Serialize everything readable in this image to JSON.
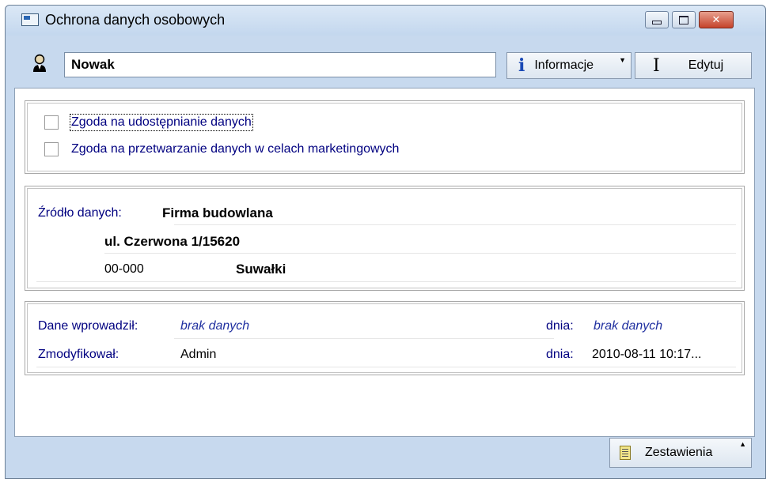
{
  "window": {
    "title": "Ochrona danych osobowych",
    "controls": {
      "minimize": "minimize",
      "maximize": "maximize",
      "close": "close"
    }
  },
  "header": {
    "name_value": "Nowak",
    "info_button": {
      "label": "Informacje",
      "icon": "info-icon"
    },
    "edit_button": {
      "label": "Edytuj",
      "icon": "text-cursor-icon"
    }
  },
  "consents": [
    {
      "label": "Zgoda na udostępnianie danych",
      "checked": false
    },
    {
      "label": "Zgoda na przetwarzanie danych w celach marketingowych",
      "checked": false
    }
  ],
  "source": {
    "label": "Źródło danych:",
    "company": "Firma budowlana",
    "street": "ul. Czerwona 1/15620",
    "postal_code": "00-000",
    "city": "Suwałki"
  },
  "audit": {
    "entered_by_label": "Dane wprowadził:",
    "entered_by_value": "brak danych",
    "entered_date_label": "dnia:",
    "entered_date_value": "brak danych",
    "modified_by_label": "Zmodyfikował:",
    "modified_by_value": "Admin",
    "modified_date_label": "dnia:",
    "modified_date_value": "2010-08-11 10:17..."
  },
  "footer": {
    "reports_button": {
      "label": "Zestawienia",
      "icon": "notepad-icon"
    }
  },
  "colors": {
    "window_bg": "#c7d9ee",
    "label_blue": "#000080",
    "italic_blue": "#2030a0",
    "info_blue": "#1a49b5",
    "close_red": "#c5432b"
  }
}
